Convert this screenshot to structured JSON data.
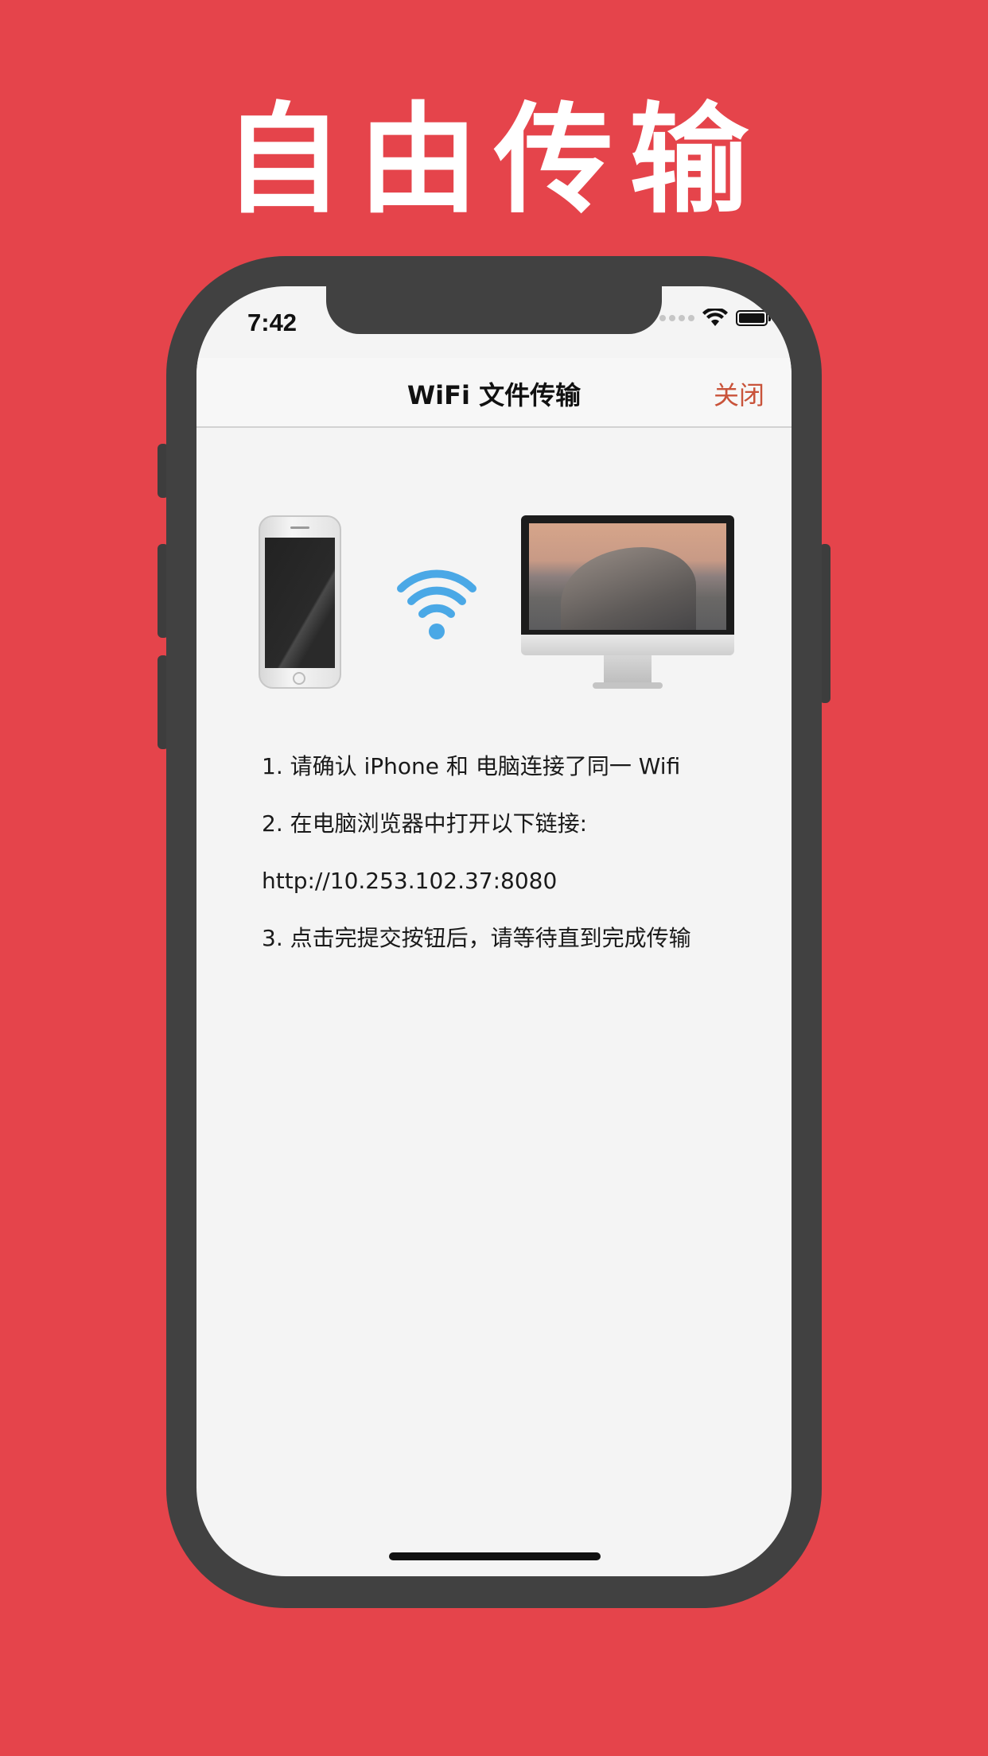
{
  "headline": "自由传输",
  "status_bar": {
    "time": "7:42",
    "wifi_icon": "wifi-icon",
    "battery_icon": "battery-icon"
  },
  "navbar": {
    "title": "WiFi 文件传输",
    "close_label": "关闭"
  },
  "illustration": {
    "left_device": "iphone-image",
    "center_icon": "wifi-icon",
    "right_device": "imac-image",
    "wifi_color": "#4aa8e6"
  },
  "instructions": {
    "step1": "1. 请确认 iPhone 和 电脑连接了同一 Wifi",
    "step2": "2. 在电脑浏览器中打开以下链接:",
    "url": "http://10.253.102.37:8080",
    "step3": "3. 点击完提交按钮后，请等待直到完成传输"
  },
  "colors": {
    "background": "#e5444b",
    "frame": "#414141",
    "screen": "#f4f4f4",
    "accent": "#c9533a"
  }
}
